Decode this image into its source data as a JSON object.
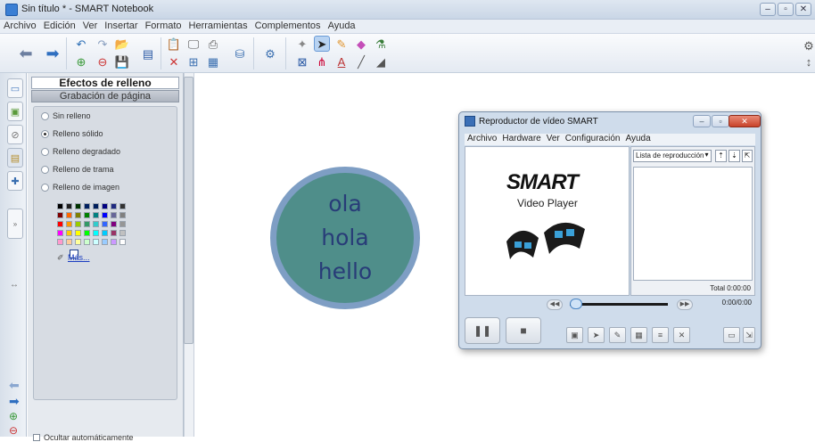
{
  "window": {
    "title": "Sin título * - SMART Notebook"
  },
  "menu": [
    "Archivo",
    "Edición",
    "Ver",
    "Insertar",
    "Formato",
    "Herramientas",
    "Complementos",
    "Ayuda"
  ],
  "panel": {
    "title": "Efectos de relleno",
    "subtitle": "Grabación de página",
    "options": [
      {
        "label": "Sin relleno",
        "selected": false
      },
      {
        "label": "Relleno sólido",
        "selected": true
      },
      {
        "label": "Relleno degradado",
        "selected": false
      },
      {
        "label": "Relleno de trama",
        "selected": false
      },
      {
        "label": "Relleno de imagen",
        "selected": false
      }
    ],
    "more_label": "Más...",
    "hide_label": "Ocultar automáticamente",
    "palette": [
      [
        "#000000",
        "#1f1f1f",
        "#003300",
        "#002060",
        "#001f5c",
        "#000080",
        "#1f2a80",
        "#333333"
      ],
      [
        "#7f0000",
        "#ff6600",
        "#808000",
        "#008000",
        "#008080",
        "#0000ff",
        "#666699",
        "#808080"
      ],
      [
        "#ff0000",
        "#ff9900",
        "#99cc00",
        "#339966",
        "#33cccc",
        "#3366ff",
        "#800080",
        "#969696"
      ],
      [
        "#ff00ff",
        "#ffcc00",
        "#ffff00",
        "#00ff00",
        "#00ffff",
        "#00ccff",
        "#993366",
        "#c0c0c0"
      ],
      [
        "#ff99cc",
        "#ffcc99",
        "#ffff99",
        "#ccffcc",
        "#ccffff",
        "#99ccff",
        "#cc99ff",
        "#ffffff"
      ]
    ]
  },
  "canvas": {
    "circle_lines": [
      "ola",
      "hola",
      "hello"
    ],
    "circle_fill": "#4f8e8a",
    "circle_border": "#7e9ec4",
    "text_color": "#283c78"
  },
  "video_player": {
    "title": "Reproductor de vídeo SMART",
    "menu": [
      "Archivo",
      "Hardware",
      "Ver",
      "Configuración",
      "Ayuda"
    ],
    "logo_text": "SMART",
    "logo_sub": "Video Player",
    "playlist_label": "Lista de reproducción",
    "total_label": "Total 0:00:00",
    "time_label": "0:00/0:00"
  }
}
